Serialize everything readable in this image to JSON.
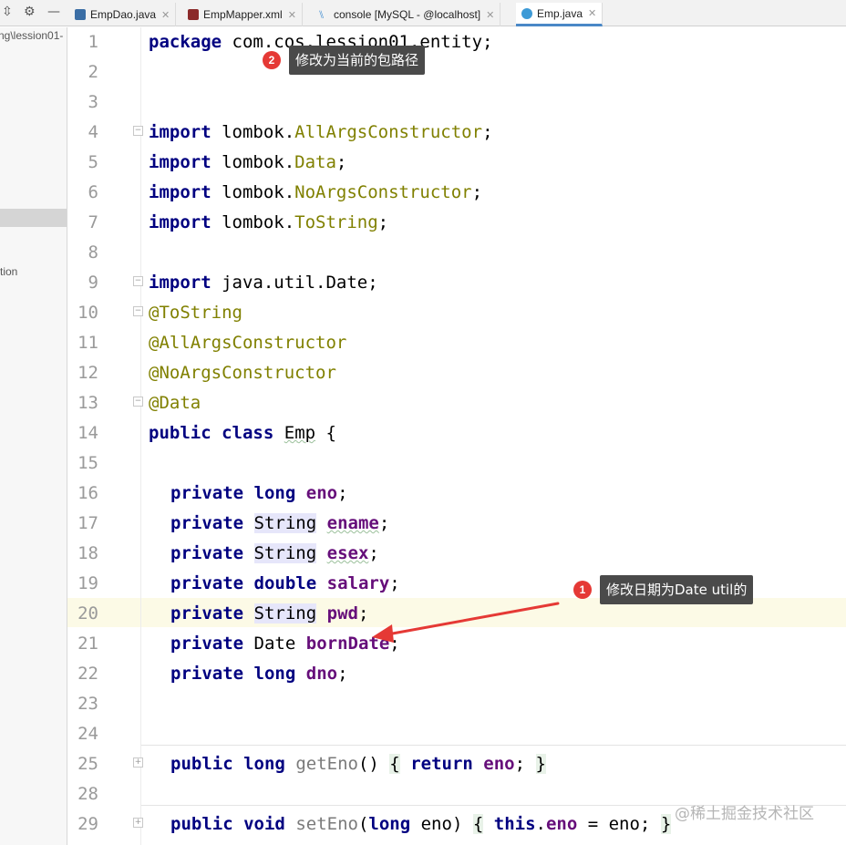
{
  "project": {
    "path_fragment": "ng\\lession01-",
    "item_fragment": "tion"
  },
  "tabs": [
    {
      "label": "EmpDao.java",
      "icon": "java-interface-icon",
      "active": false
    },
    {
      "label": "EmpMapper.xml",
      "icon": "mybatis-xml-icon",
      "active": false
    },
    {
      "label": "console [MySQL - @localhost]",
      "icon": "sql-console-icon",
      "active": false
    },
    {
      "label": "Emp.java",
      "icon": "java-class-icon",
      "active": true
    }
  ],
  "editor": {
    "line_numbers": [
      "1",
      "2",
      "3",
      "4",
      "5",
      "6",
      "7",
      "8",
      "9",
      "10",
      "11",
      "12",
      "13",
      "14",
      "15",
      "16",
      "17",
      "18",
      "19",
      "20",
      "21",
      "22",
      "23",
      "24",
      "25",
      "28",
      "29"
    ],
    "code": {
      "pkg_kw": "package",
      "pkg_name": " com.cos.lession01.entity;",
      "imp_kw": "import",
      "imp1_pre": " lombok.",
      "imp1_cls": "AllArgsConstructor",
      "imp1_end": ";",
      "imp2_pre": " lombok.",
      "imp2_cls": "Data",
      "imp2_end": ";",
      "imp3_pre": " lombok.",
      "imp3_cls": "NoArgsConstructor",
      "imp3_end": ";",
      "imp4_pre": " lombok.",
      "imp4_cls": "ToString",
      "imp4_end": ";",
      "imp5": " java.util.Date;",
      "ann1": "@ToString",
      "ann2": "@AllArgsConstructor",
      "ann3": "@NoArgsConstructor",
      "ann4": "@Data",
      "public_kw": "public",
      "class_kw": "class",
      "class_name": "Emp",
      "brace_open": " {",
      "private_kw": "private",
      "t_long": "long",
      "t_string": "String",
      "t_double": "double",
      "t_date": "Date",
      "t_void": "void",
      "f_eno": "eno",
      "f_ename": "ename",
      "f_esex": "esex",
      "f_salary": "salary",
      "f_pwd": "pwd",
      "f_borndate": "bornDate",
      "f_dno": "dno",
      "semi": ";",
      "m_geteno": "getEno",
      "parens": "()",
      "lbrace": "{",
      "rbrace": "}",
      "return_kw": "return",
      "m_seteno": "setEno",
      "lparen": "(",
      "rparen": ")",
      "p_eno": " eno",
      "this_kw": "this",
      "dot": ".",
      "assign": " = eno; "
    }
  },
  "annotations": {
    "badge1": "1",
    "note1": "修改日期为Date util的",
    "badge2": "2",
    "note2": "修改为当前的包路径",
    "arrow_color": "#e53935"
  },
  "watermark": "@稀土掘金技术社区",
  "colors": {
    "keyword": "#000080",
    "annotation": "#808000",
    "field": "#660e7a",
    "current_line": "#fcfae6"
  }
}
